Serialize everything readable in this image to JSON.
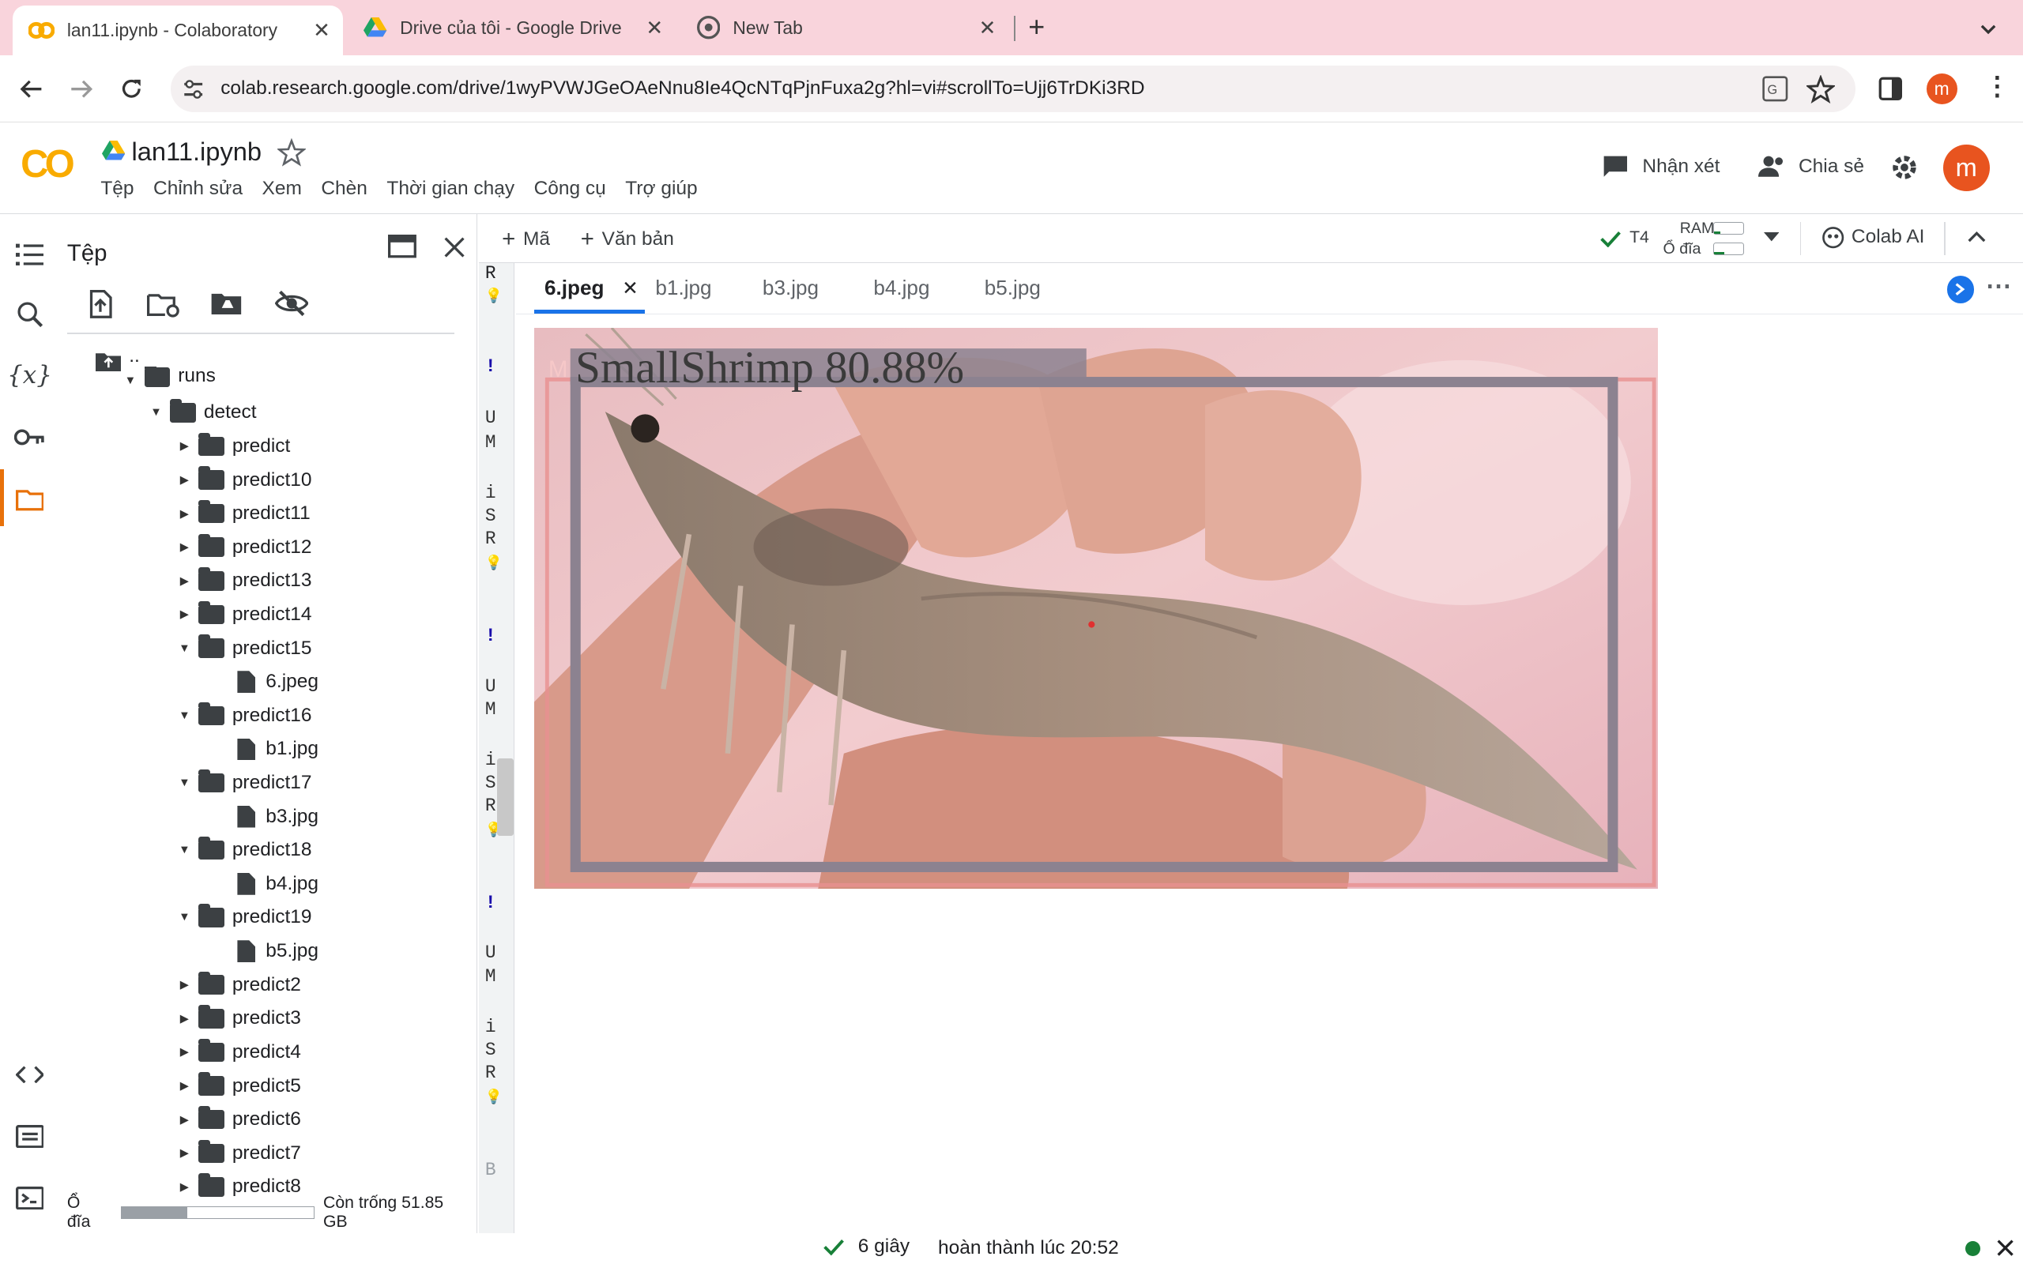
{
  "browser": {
    "tabs": [
      {
        "title": "lan11.ipynb - Colaboratory"
      },
      {
        "title": "Drive của tôi - Google Drive"
      },
      {
        "title": "New Tab"
      }
    ],
    "url": "colab.research.google.com/drive/1wyPVWJGeOAeNnu8Ie4QcNTqPjnFuxa2g?hl=vi#scrollTo=Ujj6TrDKi3RD",
    "profile_initial": "m"
  },
  "colab": {
    "logo": "CO",
    "notebook_name": "lan11.ipynb",
    "menu": [
      "Tệp",
      "Chỉnh sửa",
      "Xem",
      "Chèn",
      "Thời gian chạy",
      "Công cụ",
      "Trợ giúp"
    ],
    "comment_label": "Nhận xét",
    "share_label": "Chia sẻ",
    "avatar_initial": "m"
  },
  "files_panel": {
    "title": "Tệp",
    "parent": "..",
    "root_partial": "runs",
    "detect": "detect",
    "folders": [
      {
        "name": "predict",
        "open": false
      },
      {
        "name": "predict10",
        "open": false
      },
      {
        "name": "predict11",
        "open": false
      },
      {
        "name": "predict12",
        "open": false
      },
      {
        "name": "predict13",
        "open": false
      },
      {
        "name": "predict14",
        "open": false
      },
      {
        "name": "predict15",
        "open": true,
        "file": "6.jpeg"
      },
      {
        "name": "predict16",
        "open": true,
        "file": "b1.jpg"
      },
      {
        "name": "predict17",
        "open": true,
        "file": "b3.jpg"
      },
      {
        "name": "predict18",
        "open": true,
        "file": "b4.jpg"
      },
      {
        "name": "predict19",
        "open": true,
        "file": "b5.jpg"
      },
      {
        "name": "predict2",
        "open": false
      },
      {
        "name": "predict3",
        "open": false
      },
      {
        "name": "predict4",
        "open": false
      },
      {
        "name": "predict5",
        "open": false
      },
      {
        "name": "predict6",
        "open": false
      },
      {
        "name": "predict7",
        "open": false
      },
      {
        "name": "predict8",
        "open": false
      }
    ],
    "disk_label": "Ổ đĩa",
    "disk_free": "Còn trống 51.85 GB",
    "disk_used_fraction": 0.34
  },
  "toolbar": {
    "add_code": "Mã",
    "add_text": "Văn bản",
    "runtime": "T4",
    "ram_label": "RAM",
    "disk_label": "Ổ đĩa",
    "colab_ai": "Colab AI"
  },
  "cell_strip": [
    "R",
    "!",
    "U",
    "M",
    "i",
    "S",
    "R",
    "!",
    "U",
    "M",
    "i",
    "S",
    "R",
    "!",
    "U",
    "M",
    "i",
    "S",
    "R",
    "B"
  ],
  "file_tabs": [
    "6.jpeg",
    "b1.jpg",
    "b3.jpg",
    "b4.jpg",
    "b5.jpg"
  ],
  "detection": {
    "label": "SmallShrimp 80.88%",
    "watermark": "M"
  },
  "status_bar": {
    "duration": "6 giây",
    "completed": "hoàn thành lúc 20:52"
  },
  "colors": {
    "tabbar_bg": "#f9d4dc",
    "colab_orange": "#f9ab00",
    "avatar": "#e8541f",
    "accent_blue": "#1a73e8",
    "ok_green": "#188038"
  }
}
